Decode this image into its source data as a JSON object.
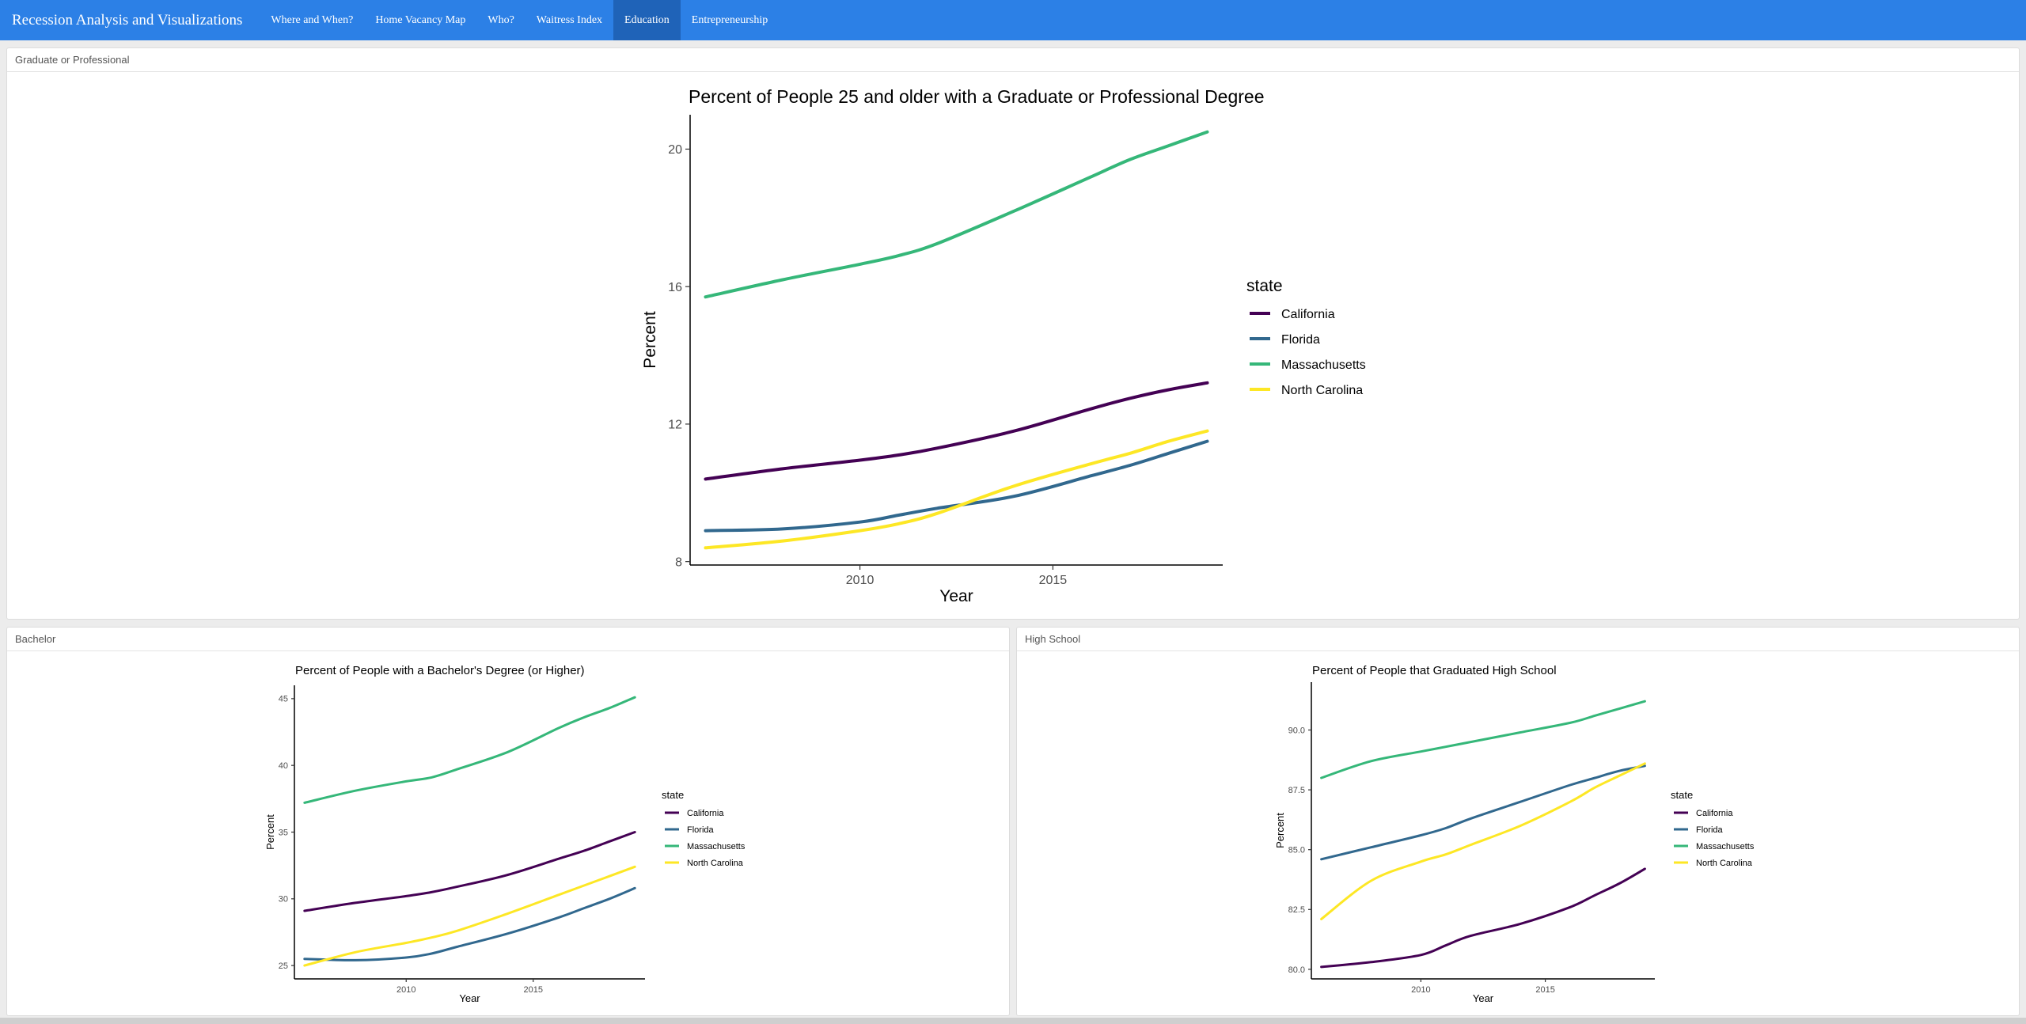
{
  "app": {
    "title": "Recession Analysis and Visualizations",
    "tabs": [
      {
        "label": "Where and When?",
        "active": false
      },
      {
        "label": "Home Vacancy Map",
        "active": false
      },
      {
        "label": "Who?",
        "active": false
      },
      {
        "label": "Waitress Index",
        "active": false
      },
      {
        "label": "Education",
        "active": true
      },
      {
        "label": "Entrepreneurship",
        "active": false
      }
    ]
  },
  "panels": {
    "grad": {
      "header": "Graduate or Professional"
    },
    "bach": {
      "header": "Bachelor"
    },
    "hs": {
      "header": "High School"
    }
  },
  "colors": {
    "navbar": "#2c80e6",
    "active_tab": "#1f63b8",
    "California": "#440154",
    "Florida": "#31688e",
    "Massachusetts": "#35b779",
    "North Carolina": "#fde725"
  },
  "chart_data": [
    {
      "type": "line",
      "title": "Percent of People 25 and older with a Graduate or Professional Degree",
      "xlabel": "Year",
      "ylabel": "Percent",
      "xlim": [
        2005.6,
        2019.4
      ],
      "ylim": [
        7.9,
        21.0
      ],
      "xticks": [
        2010,
        2015
      ],
      "xtick_labels": [
        "2010",
        "2015"
      ],
      "yticks": [
        8,
        12,
        16,
        20
      ],
      "ytick_labels": [
        "8",
        "12",
        "16",
        "20"
      ],
      "legend_title": "state",
      "legend_position": "right",
      "grid": false,
      "x": [
        2006,
        2008,
        2010,
        2011,
        2012,
        2014,
        2016,
        2017,
        2018,
        2019
      ],
      "series": [
        {
          "name": "California",
          "values": [
            10.4,
            10.7,
            10.95,
            11.1,
            11.3,
            11.8,
            12.45,
            12.75,
            13.0,
            13.2
          ]
        },
        {
          "name": "Florida",
          "values": [
            8.9,
            8.95,
            9.15,
            9.35,
            9.55,
            9.9,
            10.5,
            10.8,
            11.15,
            11.5
          ]
        },
        {
          "name": "Massachusetts",
          "values": [
            15.7,
            16.2,
            16.65,
            16.9,
            17.25,
            18.2,
            19.2,
            19.7,
            20.1,
            20.5
          ]
        },
        {
          "name": "North Carolina",
          "values": [
            8.4,
            8.6,
            8.9,
            9.1,
            9.4,
            10.2,
            10.85,
            11.15,
            11.5,
            11.8
          ]
        }
      ]
    },
    {
      "type": "line",
      "title": "Percent of People with a Bachelor's Degree (or Higher)",
      "xlabel": "Year",
      "ylabel": "Percent",
      "xlim": [
        2005.6,
        2019.4
      ],
      "ylim": [
        24.0,
        46.0
      ],
      "xticks": [
        2010,
        2015
      ],
      "xtick_labels": [
        "2010",
        "2015"
      ],
      "yticks": [
        25,
        30,
        35,
        40,
        45
      ],
      "ytick_labels": [
        "25",
        "30",
        "35",
        "40",
        "45"
      ],
      "legend_title": "state",
      "legend_position": "right",
      "grid": false,
      "x": [
        2006,
        2008,
        2010,
        2011,
        2012,
        2014,
        2016,
        2017,
        2018,
        2019
      ],
      "series": [
        {
          "name": "California",
          "values": [
            29.1,
            29.7,
            30.2,
            30.5,
            30.9,
            31.8,
            33.0,
            33.6,
            34.3,
            35.0
          ]
        },
        {
          "name": "Florida",
          "values": [
            25.5,
            25.4,
            25.6,
            25.9,
            26.4,
            27.4,
            28.6,
            29.3,
            30.0,
            30.8
          ]
        },
        {
          "name": "Massachusetts",
          "values": [
            37.2,
            38.1,
            38.8,
            39.1,
            39.7,
            41.0,
            42.8,
            43.6,
            44.3,
            45.1
          ]
        },
        {
          "name": "North Carolina",
          "values": [
            25.0,
            26.0,
            26.7,
            27.1,
            27.6,
            28.9,
            30.3,
            31.0,
            31.7,
            32.4
          ]
        }
      ]
    },
    {
      "type": "line",
      "title": "Percent of People that Graduated High School",
      "xlabel": "Year",
      "ylabel": "Percent",
      "xlim": [
        2005.6,
        2019.4
      ],
      "ylim": [
        79.6,
        92.0
      ],
      "xticks": [
        2010,
        2015
      ],
      "xtick_labels": [
        "2010",
        "2015"
      ],
      "yticks": [
        80.0,
        82.5,
        85.0,
        87.5,
        90.0
      ],
      "ytick_labels": [
        "80.0",
        "82.5",
        "85.0",
        "87.5",
        "90.0"
      ],
      "legend_title": "state",
      "legend_position": "right",
      "grid": false,
      "x": [
        2006,
        2008,
        2010,
        2011,
        2012,
        2014,
        2016,
        2017,
        2018,
        2019
      ],
      "series": [
        {
          "name": "California",
          "values": [
            80.1,
            80.3,
            80.6,
            81.0,
            81.4,
            81.9,
            82.6,
            83.1,
            83.6,
            84.2
          ]
        },
        {
          "name": "Florida",
          "values": [
            84.6,
            85.1,
            85.6,
            85.9,
            86.3,
            87.0,
            87.7,
            88.0,
            88.3,
            88.5
          ]
        },
        {
          "name": "Massachusetts",
          "values": [
            88.0,
            88.7,
            89.1,
            89.3,
            89.5,
            89.9,
            90.3,
            90.6,
            90.9,
            91.2
          ]
        },
        {
          "name": "North Carolina",
          "values": [
            82.1,
            83.7,
            84.5,
            84.8,
            85.2,
            86.0,
            87.0,
            87.6,
            88.1,
            88.6
          ]
        }
      ]
    }
  ]
}
